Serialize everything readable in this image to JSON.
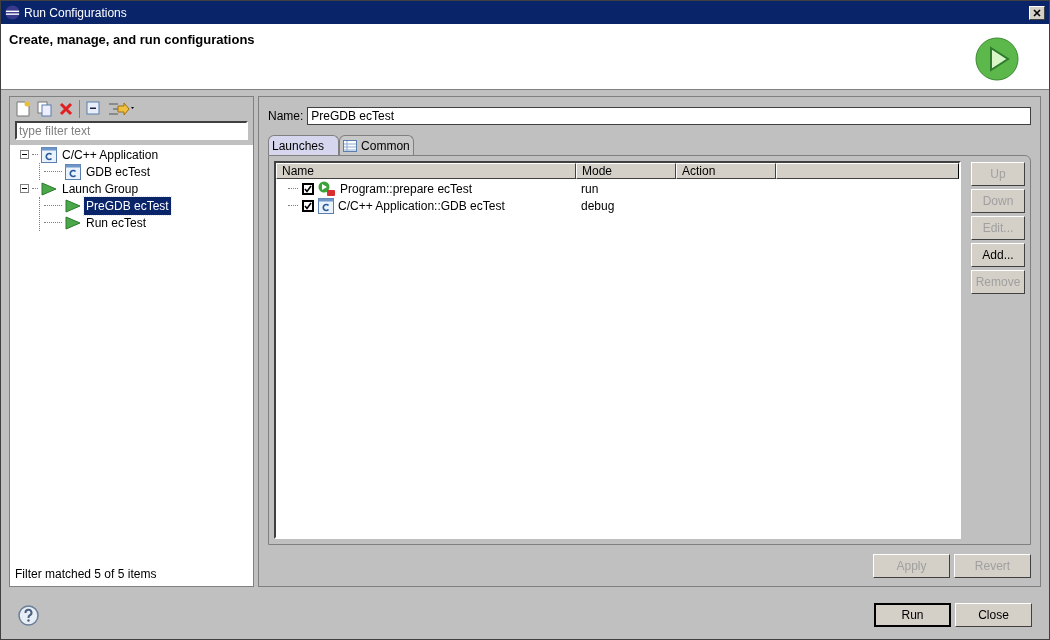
{
  "window": {
    "title": "Run Configurations"
  },
  "header": {
    "title": "Create, manage, and run configurations"
  },
  "filter": {
    "placeholder": "type filter text"
  },
  "tree": [
    {
      "label": "C/C++ Application",
      "kind": "c-app",
      "expanded": true,
      "selected": false,
      "children": [
        {
          "label": "GDB ecTest",
          "kind": "c-app",
          "selected": false
        }
      ]
    },
    {
      "label": "Launch Group",
      "kind": "launch",
      "expanded": true,
      "selected": false,
      "children": [
        {
          "label": "PreGDB ecTest",
          "kind": "launch",
          "selected": true
        },
        {
          "label": "Run ecTest",
          "kind": "launch",
          "selected": false
        }
      ]
    }
  ],
  "filter_status": "Filter matched 5 of 5 items",
  "name_field": {
    "label": "Name:",
    "value": "PreGDB ecTest"
  },
  "tabs": [
    {
      "label": "Launches",
      "selected": true
    },
    {
      "label": "Common",
      "selected": false
    }
  ],
  "table": {
    "columns": [
      "Name",
      "Mode",
      "Action"
    ],
    "rows": [
      {
        "name": "Program::prepare ecTest",
        "kind": "program",
        "checked": true,
        "mode": "run"
      },
      {
        "name": "C/C++ Application::GDB ecTest",
        "kind": "c-app",
        "checked": true,
        "mode": "debug"
      }
    ]
  },
  "side_buttons": [
    {
      "label": "Up",
      "disabled": true
    },
    {
      "label": "Down",
      "disabled": true
    },
    {
      "label": "Edit...",
      "disabled": true
    },
    {
      "label": "Add...",
      "disabled": false
    },
    {
      "label": "Remove",
      "disabled": true
    }
  ],
  "apply_buttons": [
    {
      "label": "Apply",
      "disabled": true
    },
    {
      "label": "Revert",
      "disabled": true
    }
  ],
  "dialog_buttons": [
    {
      "label": "Run",
      "disabled": false,
      "default": true
    },
    {
      "label": "Close",
      "disabled": false,
      "default": false
    }
  ]
}
